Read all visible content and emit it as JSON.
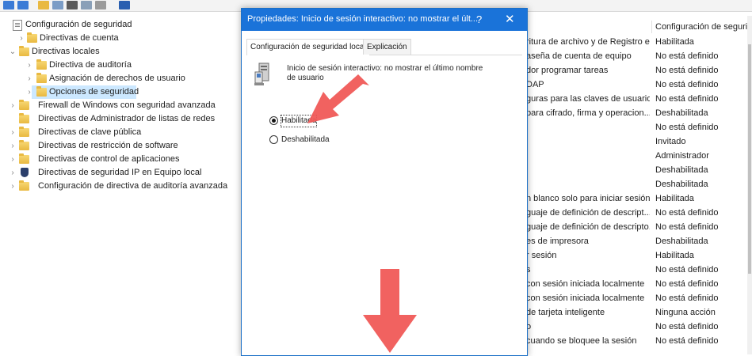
{
  "toolbar": {
    "buttons": [
      "back-icon",
      "forward-icon",
      "up-folder-icon",
      "show-tree-icon",
      "refresh-icon",
      "export-icon",
      "properties-icon",
      "help-icon"
    ]
  },
  "tree": {
    "root": "Configuración de seguridad",
    "account_policies": "Directivas de cuenta",
    "local_policies": "Directivas locales",
    "audit_policy": "Directiva de auditoría",
    "user_rights": "Asignación de derechos de usuario",
    "security_options": "Opciones de seguridad",
    "firewall": "Firewall de Windows con seguridad avanzada",
    "network_list": "Directivas de Administrador de listas de redes",
    "public_key": "Directivas de clave pública",
    "software_restriction": "Directivas de restricción de software",
    "app_control": "Directivas de control de aplicaciones",
    "ip_security": "Directivas de seguridad IP en Equipo local",
    "advanced_audit": "Configuración de directiva de auditoría avanzada"
  },
  "list": {
    "column_header": "Configuración de seguri...",
    "rows": [
      {
        "policy": "ritura de archivo y de Registro e...",
        "setting": "Habilitada"
      },
      {
        "policy": "aseña de cuenta de equipo",
        "setting": "No está definido"
      },
      {
        "policy": "dor programar tareas",
        "setting": "No está definido"
      },
      {
        "policy": "DAP",
        "setting": "No está definido"
      },
      {
        "policy": "guras para las claves de usuario a...",
        "setting": "No está definido"
      },
      {
        "policy": "para cifrado, firma y operacion...",
        "setting": "Deshabilitada"
      },
      {
        "policy": "",
        "setting": "No está definido"
      },
      {
        "policy": "",
        "setting": "Invitado"
      },
      {
        "policy": "",
        "setting": "Administrador"
      },
      {
        "policy": "",
        "setting": "Deshabilitada"
      },
      {
        "policy": "",
        "setting": "Deshabilitada"
      },
      {
        "policy": "n blanco solo para iniciar sesión...",
        "setting": "Habilitada"
      },
      {
        "policy": "guaje de definición de descript...",
        "setting": "No está definido"
      },
      {
        "policy": "guaje de definición de descripto...",
        "setting": "No está definido"
      },
      {
        "policy": "es de impresora",
        "setting": "Deshabilitada"
      },
      {
        "policy": "r sesión",
        "setting": "Habilitada"
      },
      {
        "policy": "s",
        "setting": "No está definido"
      },
      {
        "policy": "con sesión iniciada localmente",
        "setting": "No está definido"
      },
      {
        "policy": "con sesión iniciada localmente",
        "setting": "No está definido"
      },
      {
        "policy": "de tarjeta inteligente",
        "setting": "Ninguna acción"
      },
      {
        "policy": "o",
        "setting": "No está definido"
      },
      {
        "policy": "cuando se bloquee la sesión",
        "setting": "No está definido"
      }
    ]
  },
  "dialog": {
    "title": "Propiedades: Inicio de sesión interactivo: no mostrar el últ...",
    "help_glyph": "?",
    "close_glyph": "✕",
    "tab_security": "Configuración de seguridad local",
    "tab_explain": "Explicación",
    "policy_name": "Inicio de sesión interactivo: no mostrar el último nombre de usuario",
    "option_enabled": "Habilitada",
    "option_disabled": "Deshabilitada",
    "selected_option": "Habilitada"
  },
  "colors": {
    "titlebar": "#1a73d9",
    "selection": "#cce8ff",
    "arrow": "#f05a57"
  }
}
